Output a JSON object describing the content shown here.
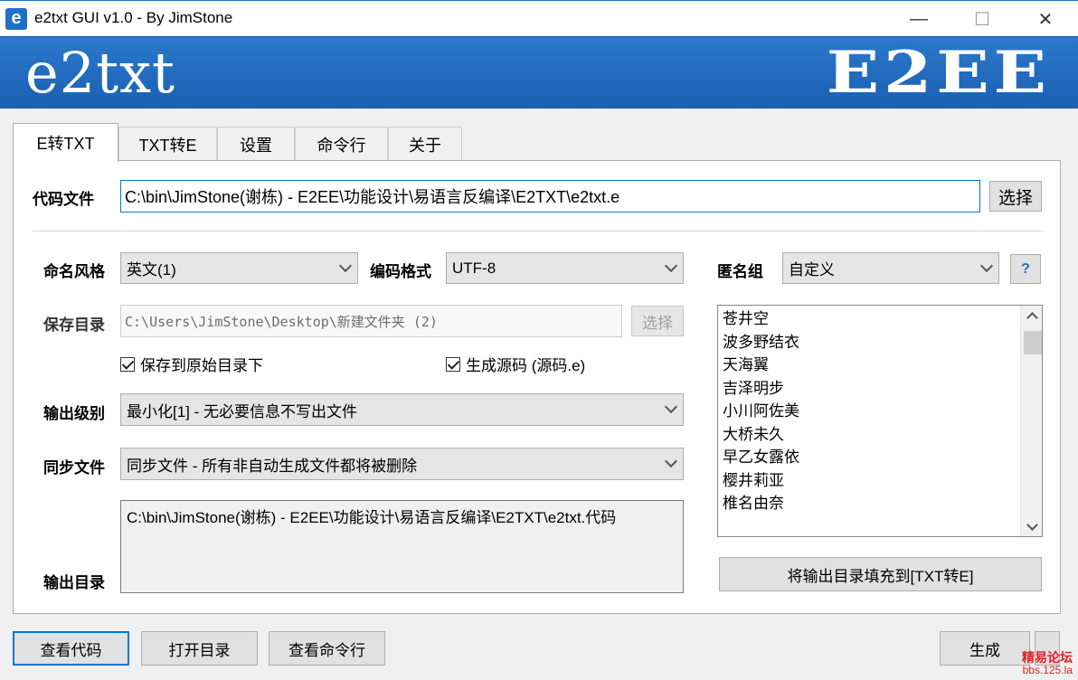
{
  "window": {
    "icon_letter": "e",
    "title": "e2txt GUI v1.0 - By JimStone",
    "minimize": "—",
    "maximize": "☐",
    "close": "✕"
  },
  "banner": {
    "left_logo": "e2txt",
    "right_logo": "E2EE"
  },
  "tabs": [
    {
      "label": "E转TXT",
      "active": true
    },
    {
      "label": "TXT转E",
      "active": false
    },
    {
      "label": "设置",
      "active": false
    },
    {
      "label": "命令行",
      "active": false
    },
    {
      "label": "关于",
      "active": false
    }
  ],
  "code_file": {
    "label": "代码文件",
    "value": "C:\\bin\\JimStone(谢栋) - E2EE\\功能设计\\易语言反编译\\E2TXT\\e2txt.e",
    "select_button": "选择"
  },
  "naming_style": {
    "label": "命名风格",
    "value": "英文(1)"
  },
  "encoding": {
    "label": "编码格式",
    "value": "UTF-8"
  },
  "anonymous_group": {
    "label": "匿名组",
    "value": "自定义",
    "help_button": "?"
  },
  "save_dir": {
    "label": "保存目录",
    "value": "C:\\Users\\JimStone\\Desktop\\新建文件夹 (2)",
    "select_button": "选择"
  },
  "checkboxes": {
    "save_to_original": {
      "label": "保存到原始目录下",
      "checked": true
    },
    "generate_source": {
      "label": "生成源码 (源码.e)",
      "checked": true
    }
  },
  "output_level": {
    "label": "输出级别",
    "value": "最小化[1] - 无必要信息不写出文件"
  },
  "sync_files": {
    "label": "同步文件",
    "value": "同步文件 - 所有非自动生成文件都将被删除"
  },
  "output_dir": {
    "label": "输出目录",
    "value": "C:\\bin\\JimStone(谢栋) - E2EE\\功能设计\\易语言反编译\\E2TXT\\e2txt.代码"
  },
  "names_list": [
    "苍井空",
    "波多野结衣",
    "天海翼",
    "吉泽明步",
    "小川阿佐美",
    "大桥未久",
    "早乙女露依",
    "樱井莉亚",
    "椎名由奈"
  ],
  "fill_button": "将输出目录填充到[TXT转E]",
  "bottom_buttons": {
    "view_code": "查看代码",
    "open_dir": "打开目录",
    "view_cmdline": "查看命令行",
    "generate": "生成"
  },
  "watermark": {
    "line1": "精易论坛",
    "line2": "bbs.125.la"
  },
  "colors": {
    "banner": "#1f6fc4",
    "focus": "#0078d7"
  }
}
